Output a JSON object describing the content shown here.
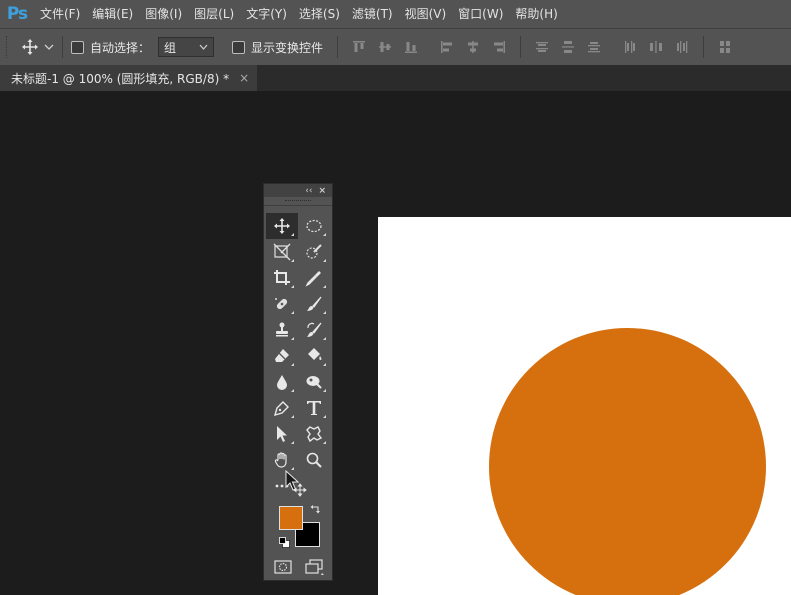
{
  "app": {
    "logo": "Ps"
  },
  "menu": [
    "文件(F)",
    "编辑(E)",
    "图像(I)",
    "图层(L)",
    "文字(Y)",
    "选择(S)",
    "滤镜(T)",
    "视图(V)",
    "窗口(W)",
    "帮助(H)"
  ],
  "options_bar": {
    "move_tool_icon": "move-icon",
    "auto_select_label": "自动选择：",
    "auto_select_checked": false,
    "auto_select_target": "组",
    "show_transform_label": "显示变换控件",
    "show_transform_checked": false
  },
  "document_tab": {
    "title": "未标题-1 @ 100% (圆形填充, RGB/8) *",
    "close": "×"
  },
  "toolbox": {
    "collapse": "‹‹",
    "close": "×",
    "foreground_color": "#d66f0d",
    "background_color": "#000000"
  },
  "canvas": {
    "background": "#ffffff",
    "circle_color": "#d66f0d"
  }
}
